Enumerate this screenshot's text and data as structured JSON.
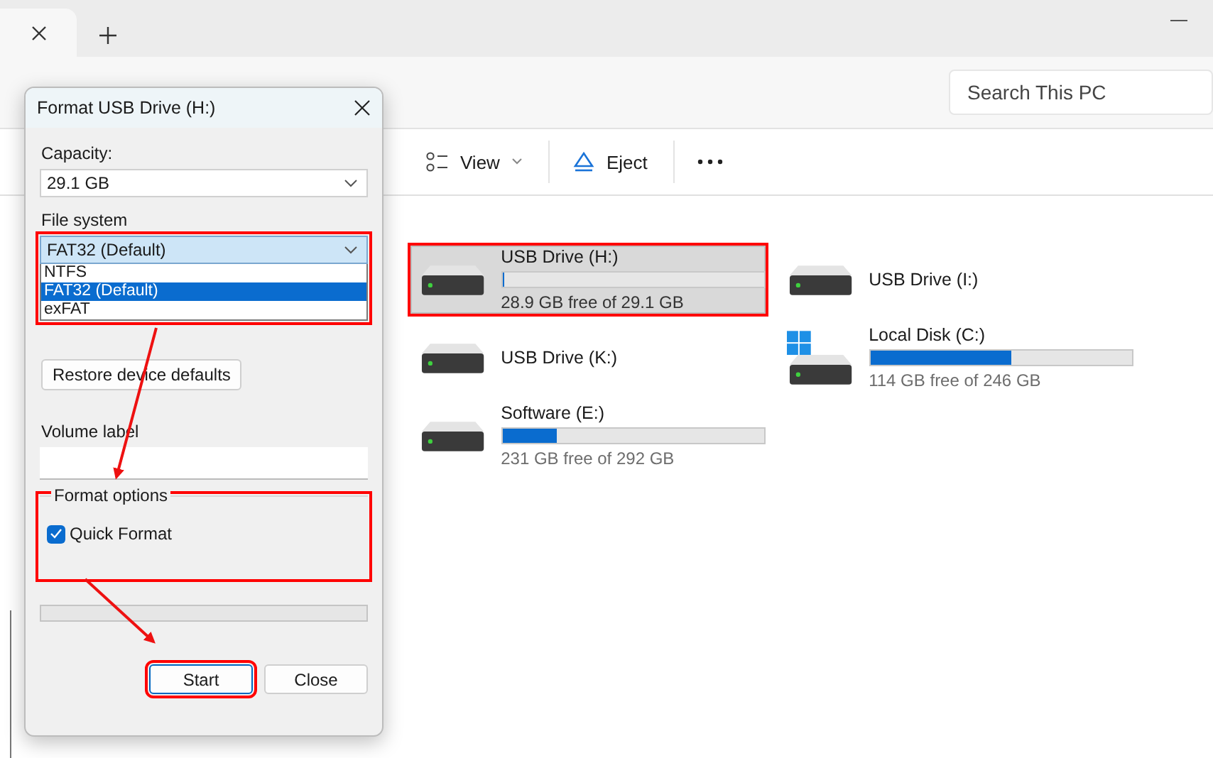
{
  "explorer": {
    "search": {
      "placeholder": "Search This PC"
    },
    "toolbar": [
      {
        "kind": "view",
        "label": "View"
      },
      {
        "kind": "eject",
        "label": "Eject"
      },
      {
        "kind": "more"
      }
    ],
    "drives": [
      {
        "kind": "usb",
        "name": "USB Drive (H:)",
        "level": 0.01,
        "reading": "28.9 GB free of 29.1 GB",
        "selected": true,
        "highlighted": true
      },
      {
        "kind": "usb",
        "name": "USB Drive (I:)",
        "selected": false,
        "highlighted": false
      },
      {
        "kind": "usb",
        "name": "USB Drive (K:)",
        "selected": false,
        "highlighted": false
      },
      {
        "kind": "system",
        "name": "Local Disk (C:)",
        "level": 0.54,
        "reading": "114 GB free of 246 GB",
        "selected": false,
        "highlighted": false
      },
      {
        "kind": "usb",
        "name": "Software (E:)",
        "level": 0.21,
        "reading": "231 GB free of 292 GB",
        "selected": false,
        "highlighted": false
      }
    ]
  },
  "dialog": {
    "title": "Format USB Drive (H:)",
    "capacity": {
      "label": "Capacity:",
      "value": "29.1 GB"
    },
    "file_system": {
      "label": "File system",
      "value": "FAT32 (Default)",
      "highlighted": true,
      "options": [
        {
          "label": "NTFS",
          "selected": false
        },
        {
          "label": "FAT32 (Default)",
          "selected": true
        },
        {
          "label": "exFAT",
          "selected": false
        }
      ]
    },
    "restore_button": "Restore device defaults",
    "volume_label": {
      "label": "Volume label"
    },
    "format_options": {
      "title": "Format options",
      "highlighted": true,
      "quick_format": {
        "label": "Quick Format",
        "checked": true
      }
    },
    "progress": {
      "level": 0
    },
    "buttons": [
      {
        "label": "Start",
        "focused": true,
        "highlighted": true
      },
      {
        "label": "Close",
        "focused": false,
        "highlighted": false
      }
    ]
  }
}
